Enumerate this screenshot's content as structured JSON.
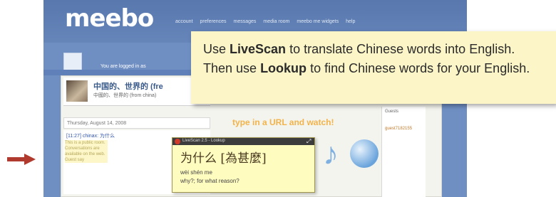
{
  "app": {
    "logo": "meebo",
    "nav": [
      "account",
      "preferences",
      "messages",
      "media room",
      "meebo me widgets",
      "help"
    ],
    "logged_in_text": "You are logged in as"
  },
  "conversation": {
    "title": "中国的、世界的 (fre",
    "subtitle": "中國的、世界的 (from china)",
    "date": "Thursday, August 14, 2008",
    "sender": "[11:27] chinax: 为什么",
    "message": "This is a public room. Conversations are available on the web. Guest say"
  },
  "widget": {
    "headline": "type in a URL and watch!",
    "guests_label": "Guests",
    "guest_name": "guest7182155"
  },
  "popup": {
    "bar_title": "LiveScan 2.5 - Lookup",
    "chars": "为什么 [為甚麼]",
    "pinyin": "wèi shén me",
    "definition": "why?; for what reason?"
  },
  "callout": {
    "text_1": "Use ",
    "term_1": "LiveScan",
    "text_2": " to translate Chinese words into English. Then use ",
    "term_2": "Lookup",
    "text_3": " to find Chinese words for your English."
  },
  "colors": {
    "arrow": "#b03a2e",
    "callout_bg": "#fcf5c7",
    "accent": "#f2b34a"
  }
}
